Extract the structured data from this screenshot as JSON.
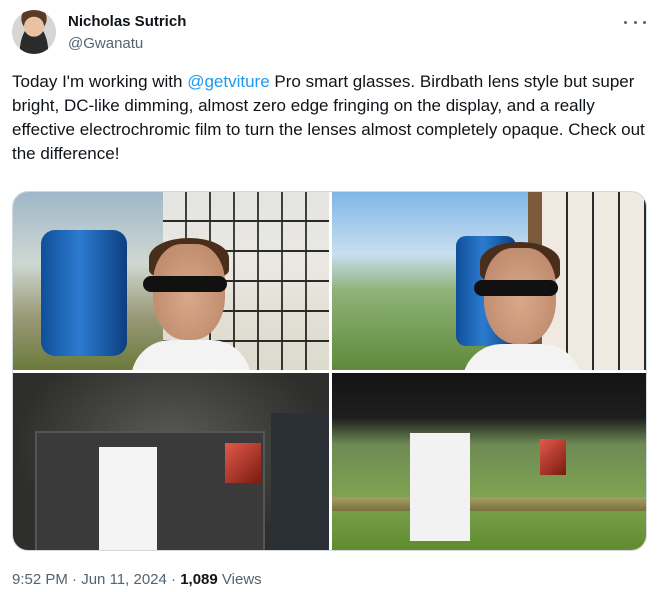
{
  "author": {
    "name": "Nicholas Sutrich",
    "handle": "@Gwanatu",
    "avatar_icon": "profile-photo"
  },
  "tweet": {
    "text_before": "Today I'm working with ",
    "mention": "@getviture",
    "text_after": " Pro smart glasses. Birdbath lens style but super bright, DC-like dimming, almost zero edge fringing on the display, and a really effective electrochromic film to turn the lenses almost completely opaque. Check out the difference!"
  },
  "media": {
    "count": 4,
    "photos": [
      {
        "alt": ""
      },
      {
        "alt": ""
      },
      {
        "alt": ""
      },
      {
        "alt": ""
      }
    ]
  },
  "meta": {
    "time": "9:52 PM",
    "separator": " · ",
    "date": "Jun 11, 2024",
    "separator2": " · ",
    "views_count": "1,089",
    "views_label": " Views"
  },
  "colors": {
    "link": "#1d9bf0",
    "secondary_text": "#536471",
    "primary_text": "#0f1419"
  }
}
